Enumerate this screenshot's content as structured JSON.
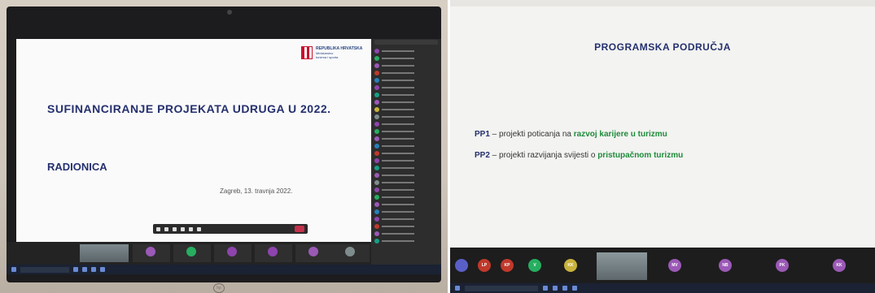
{
  "left_photo": {
    "slide": {
      "title": "SUFINANCIRANJE PROJEKATA UDRUGA U 2022.",
      "subtitle": "RADIONICA",
      "date": "Zagreb, 13. travnja 2022.",
      "ministry_lines": [
        "REPUBLIKA HRVATSKA",
        "Ministarstvo",
        "turizma i sporta"
      ]
    },
    "brand": "hp"
  },
  "right_photo": {
    "slide": {
      "heading": "PROGRAMSKA PODRUČJA",
      "items": [
        {
          "code": "PP1",
          "dash": " – projekti poticanja na ",
          "highlight": "razvoj karijere u turizmu"
        },
        {
          "code": "PP2",
          "dash": " – projekti razvijanja svijesti o ",
          "highlight": "pristupačnom turizmu"
        }
      ]
    },
    "participants": [
      "LP",
      "KP",
      "V",
      "KK",
      "MV",
      "NB",
      "PK",
      "KK"
    ]
  },
  "colors": {
    "title_navy": "#25306e",
    "highlight_green": "#1e8b3a",
    "leave_red": "#c4314b"
  }
}
